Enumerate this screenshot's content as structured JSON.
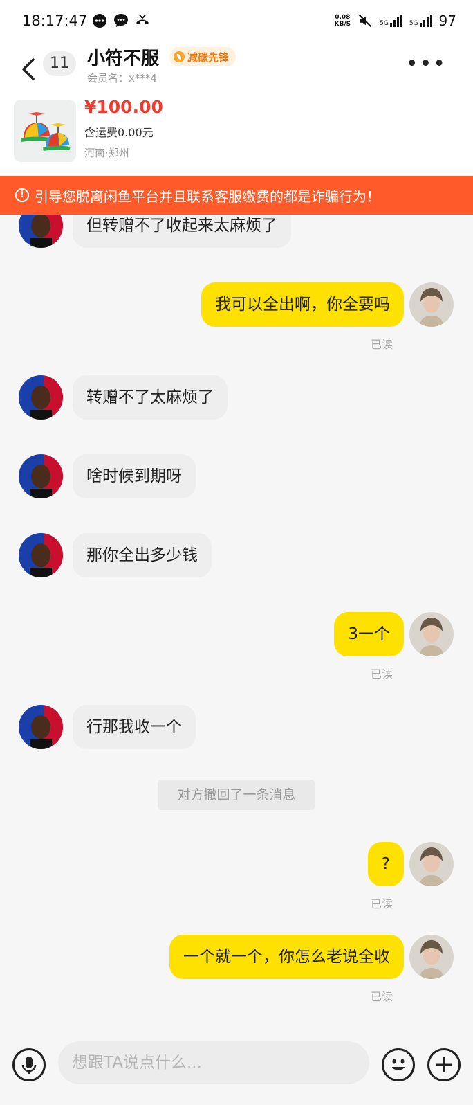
{
  "status_bar": {
    "time": "18:17:47",
    "net_speed_value": "0.08",
    "net_speed_unit": "KB/S",
    "signal1": "5G",
    "signal2": "5G",
    "battery": "97",
    "notification_icons": [
      "chat-bubble-icon",
      "message-icon",
      "missed-call-icon"
    ]
  },
  "header": {
    "unread_count": "11",
    "seller_name": "小符不服",
    "badge": "减碳先锋",
    "member_label": "会员名：x***4",
    "more": "•••"
  },
  "product": {
    "price": "¥100.00",
    "shipping": "含运费0.00元",
    "location": "河南·郑州"
  },
  "warning": {
    "text": "引导您脱离闲鱼平台并且联系客服缴费的都是诈骗行为！"
  },
  "messages": [
    {
      "side": "left",
      "text": "但转赠不了收起来太麻烦了"
    },
    {
      "side": "right",
      "text": "我可以全出啊，你全要吗",
      "status": "已读"
    },
    {
      "side": "left",
      "text": "转赠不了太麻烦了"
    },
    {
      "side": "left",
      "text": "啥时候到期呀"
    },
    {
      "side": "left",
      "text": "那你全出多少钱"
    },
    {
      "side": "right",
      "text": "3一个",
      "status": "已读"
    },
    {
      "side": "left",
      "text": "行那我收一个"
    },
    {
      "side": "system",
      "text": "对方撤回了一条消息"
    },
    {
      "side": "right",
      "text": "?",
      "status": "已读"
    },
    {
      "side": "right",
      "text": "一个就一个，你怎么老说全收",
      "status": "已读"
    }
  ],
  "input": {
    "placeholder": "想跟TA说点什么..."
  },
  "colors": {
    "warning_bg": "#ff5a2a",
    "my_bubble": "#ffe100",
    "their_bubble": "#eeeeee",
    "price": "#ee3b2f",
    "badge_text": "#f07a12"
  }
}
